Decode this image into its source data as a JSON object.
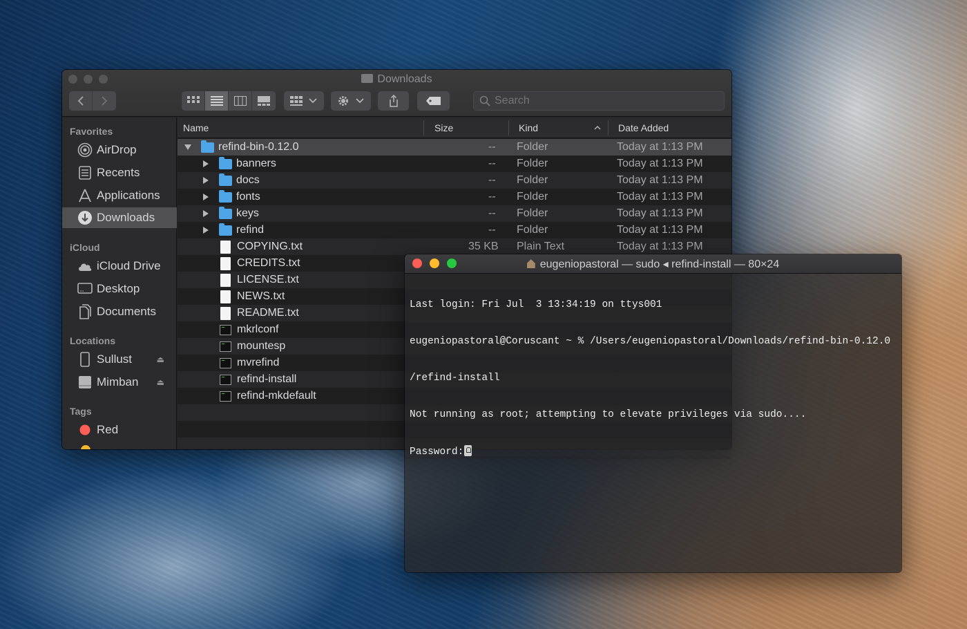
{
  "finder": {
    "title": "Downloads",
    "search_placeholder": "Search",
    "sidebar": {
      "favorites_heading": "Favorites",
      "favorites": [
        {
          "label": "AirDrop",
          "icon": "airdrop-icon"
        },
        {
          "label": "Recents",
          "icon": "recents-icon"
        },
        {
          "label": "Applications",
          "icon": "applications-icon"
        },
        {
          "label": "Downloads",
          "icon": "downloads-icon",
          "selected": true
        }
      ],
      "icloud_heading": "iCloud",
      "icloud": [
        {
          "label": "iCloud Drive",
          "icon": "cloud-icon"
        },
        {
          "label": "Desktop",
          "icon": "desktop-icon"
        },
        {
          "label": "Documents",
          "icon": "documents-icon"
        }
      ],
      "locations_heading": "Locations",
      "locations": [
        {
          "label": "Sullust",
          "icon": "phone-icon"
        },
        {
          "label": "Mimban",
          "icon": "disk-icon"
        }
      ],
      "tags_heading": "Tags",
      "tags": [
        {
          "label": "Red",
          "color": "#ff5f57"
        }
      ]
    },
    "columns": {
      "name": "Name",
      "size": "Size",
      "kind": "Kind",
      "date_added": "Date Added"
    },
    "rows": [
      {
        "name": "refind-bin-0.12.0",
        "size": "--",
        "kind": "Folder",
        "date": "Today at 1:13 PM"
      },
      {
        "name": "banners",
        "size": "--",
        "kind": "Folder",
        "date": "Today at 1:13 PM"
      },
      {
        "name": "docs",
        "size": "--",
        "kind": "Folder",
        "date": "Today at 1:13 PM"
      },
      {
        "name": "fonts",
        "size": "--",
        "kind": "Folder",
        "date": "Today at 1:13 PM"
      },
      {
        "name": "keys",
        "size": "--",
        "kind": "Folder",
        "date": "Today at 1:13 PM"
      },
      {
        "name": "refind",
        "size": "--",
        "kind": "Folder",
        "date": "Today at 1:13 PM"
      },
      {
        "name": "COPYING.txt",
        "size": "35 KB",
        "kind": "Plain Text",
        "date": "Today at 1:13 PM"
      },
      {
        "name": "CREDITS.txt"
      },
      {
        "name": "LICENSE.txt"
      },
      {
        "name": "NEWS.txt"
      },
      {
        "name": "README.txt"
      },
      {
        "name": "mkrlconf"
      },
      {
        "name": "mountesp"
      },
      {
        "name": "mvrefind"
      },
      {
        "name": "refind-install"
      },
      {
        "name": "refind-mkdefault"
      }
    ]
  },
  "terminal": {
    "title_user": "eugeniopastoral",
    "title_rest": "— sudo ◂ refind-install — 80×24",
    "lines": [
      "Last login: Fri Jul  3 13:34:19 on ttys001",
      "eugeniopastoral@Coruscant ~ % /Users/eugeniopastoral/Downloads/refind-bin-0.12.0",
      "/refind-install",
      "Not running as root; attempting to elevate privileges via sudo....",
      "Password:"
    ]
  }
}
